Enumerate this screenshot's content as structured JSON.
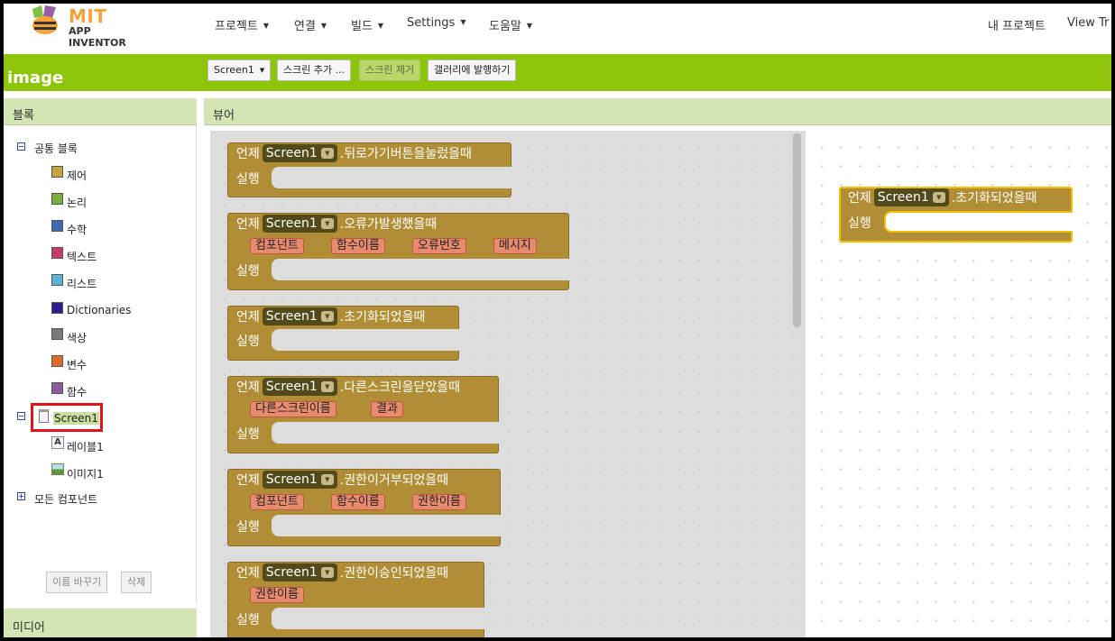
{
  "nav": {
    "logo_top": "MIT",
    "logo_bottom": "APP INVENTOR",
    "menus": [
      "프로젝트",
      "연결",
      "빌드",
      "Settings",
      "도움말"
    ],
    "my_projects": "내 프로젝트",
    "view_trash": "View Tr"
  },
  "toolbar": {
    "project_name": "image",
    "screen_select": "Screen1",
    "add_screen": "스크린 추가 ...",
    "remove_screen": "스크린 제거",
    "publish_gallery": "갤러리에 발행하기"
  },
  "blocks_panel": {
    "title": "블록",
    "builtin_label": "공통 블록",
    "builtin_items": [
      {
        "label": "제어",
        "color": "#c8a43f"
      },
      {
        "label": "논리",
        "color": "#7dad3d"
      },
      {
        "label": "수학",
        "color": "#3f6ab2"
      },
      {
        "label": "텍스트",
        "color": "#c33d68"
      },
      {
        "label": "리스트",
        "color": "#5cb3d8"
      },
      {
        "label": "Dictionaries",
        "color": "#2d1e8c"
      },
      {
        "label": "색상",
        "color": "#7a7a7a"
      },
      {
        "label": "변수",
        "color": "#e06c2a"
      },
      {
        "label": "함수",
        "color": "#8c5b9c"
      }
    ],
    "screen_label": "Screen1",
    "components": [
      {
        "label": "레이블1",
        "icon": "label-icon"
      },
      {
        "label": "이미지1",
        "icon": "image-icon"
      }
    ],
    "all_components": "모든 컴포넌트",
    "rename_button": "이름 바꾸기",
    "delete_button": "삭제",
    "media_title": "미디어"
  },
  "viewer": {
    "title": "뷰어",
    "when": "언제",
    "do": "실행",
    "component": "Screen1",
    "flyout_blocks": [
      {
        "event": ".뒤로가기버튼을눌렀을때",
        "params": []
      },
      {
        "event": ".오류가발생했을때",
        "params": [
          "컴포넌트",
          "함수이름",
          "오류번호",
          "메시지"
        ]
      },
      {
        "event": ".초기화되었을때",
        "params": []
      },
      {
        "event": ".다른스크린을닫았을때",
        "params": [
          "다른스크린이름",
          "결과"
        ]
      },
      {
        "event": ".권한이거부되었을때",
        "params": [
          "컴포넌트",
          "함수이름",
          "권한이름"
        ]
      },
      {
        "event": ".권한이승인되었을때",
        "params": [
          "권한이름"
        ]
      }
    ],
    "workspace_block": {
      "event": ".초기화되었을때"
    }
  }
}
